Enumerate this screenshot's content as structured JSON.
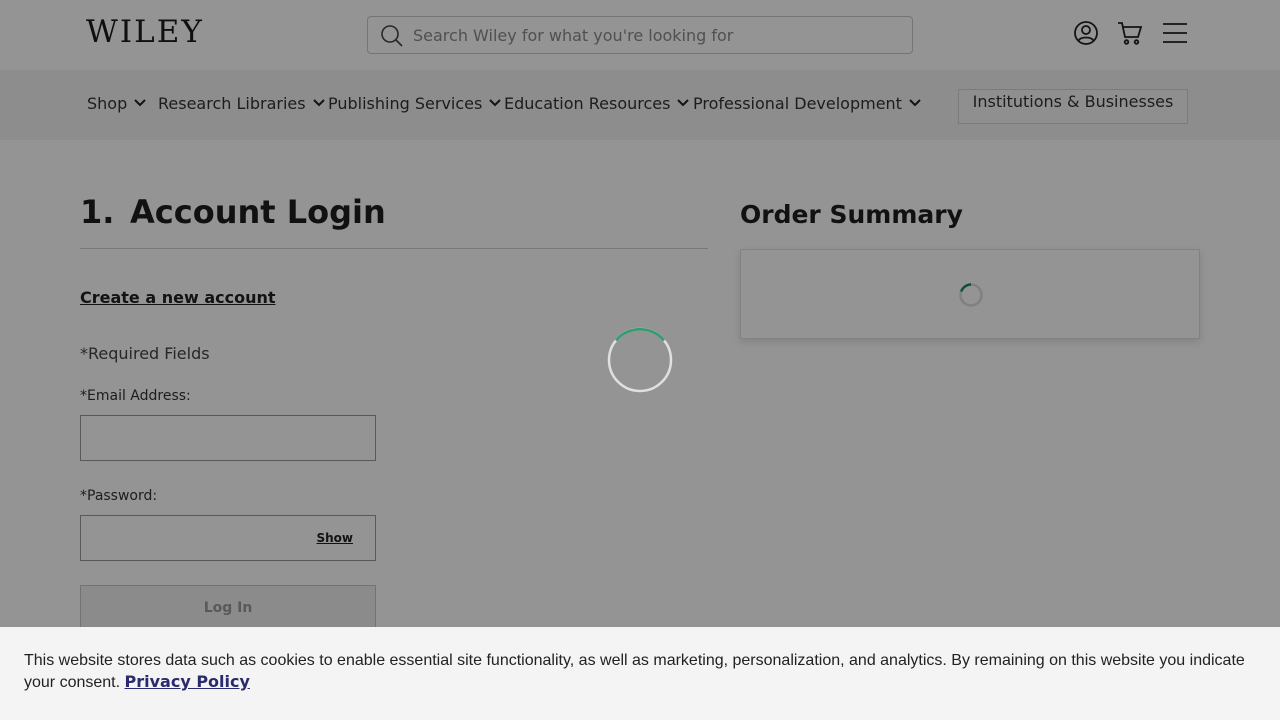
{
  "header": {
    "logo": "WILEY",
    "search_placeholder": "Search Wiley for what you're looking for",
    "icons": [
      "account-icon",
      "cart-icon",
      "menu-icon"
    ]
  },
  "nav": {
    "items": [
      {
        "label": "Shop"
      },
      {
        "label": "Research Libraries"
      },
      {
        "label": "Publishing Services"
      },
      {
        "label": "Education Resources"
      },
      {
        "label": "Professional Development"
      }
    ],
    "institutions_button": "Institutions & Businesses"
  },
  "login": {
    "step_number": "1.",
    "heading": "Account Login",
    "create_account_link": "Create a new account",
    "required_note": "*Required Fields",
    "email_label": "*Email Address:",
    "email_value": "",
    "password_label": "*Password:",
    "password_value": "",
    "show_toggle": "Show",
    "login_button": "Log In"
  },
  "order_summary": {
    "title": "Order Summary"
  },
  "cookie_banner": {
    "text": "This website stores data such as cookies to enable essential site functionality, as well as marketing, personalization, and analytics. By remaining on this website you indicate your consent.",
    "link": "Privacy Policy"
  },
  "colors": {
    "spinner_accent": "#1f8a5e",
    "overlay": "rgba(0,0,0,0.42)",
    "link": "#2a2a6c"
  }
}
